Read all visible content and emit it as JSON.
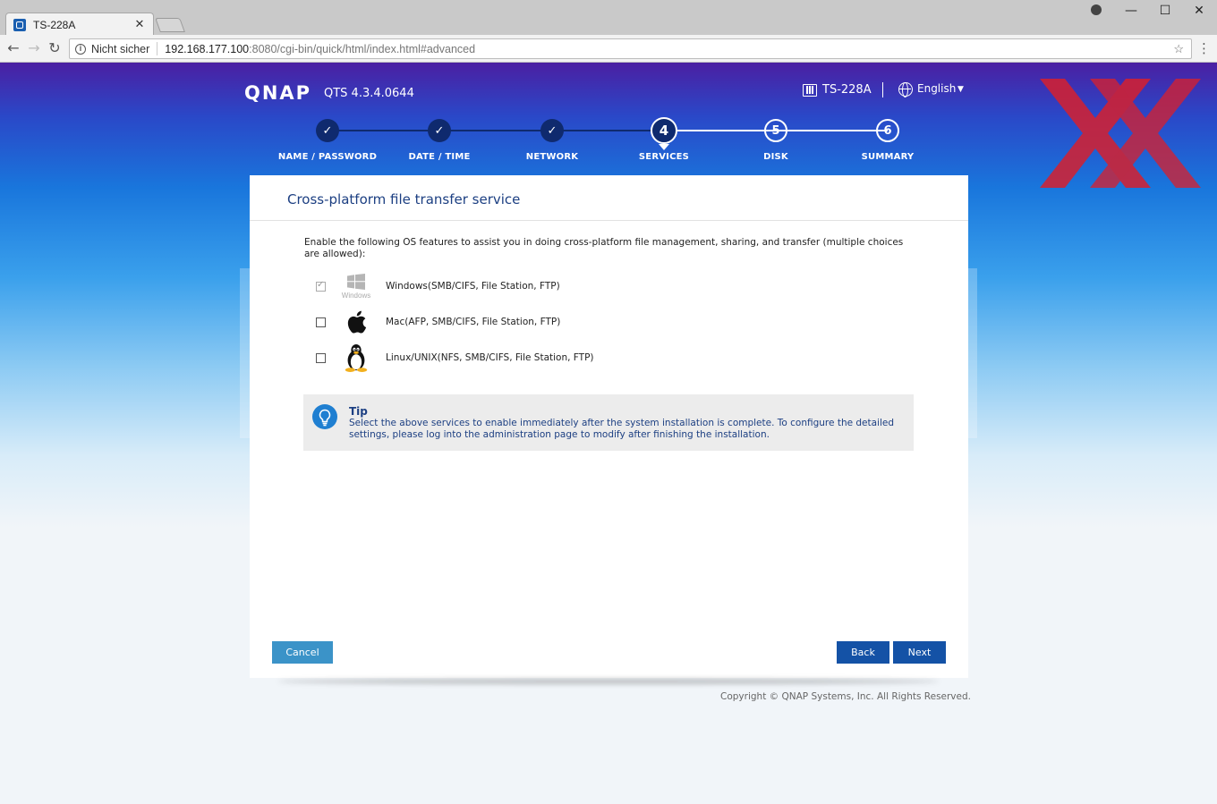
{
  "browser": {
    "tab_title": "TS-228A",
    "tab_close": "✕",
    "security_label": "Nicht sicher",
    "url_host": "192.168.177.100",
    "url_path": ":8080/cgi-bin/quick/html/index.html#advanced",
    "window_minimize": "—",
    "window_maximize": "☐",
    "window_close": "✕"
  },
  "header": {
    "logo": "QNAP",
    "version": "QTS 4.3.4.0644",
    "device_name": "TS-228A",
    "language": "English"
  },
  "steps": [
    {
      "number": "✓",
      "label": "NAME / PASSWORD",
      "state": "done"
    },
    {
      "number": "✓",
      "label": "DATE / TIME",
      "state": "done"
    },
    {
      "number": "✓",
      "label": "NETWORK",
      "state": "done"
    },
    {
      "number": "4",
      "label": "SERVICES",
      "state": "active"
    },
    {
      "number": "5",
      "label": "DISK",
      "state": "future"
    },
    {
      "number": "6",
      "label": "SUMMARY",
      "state": "future"
    }
  ],
  "card": {
    "title": "Cross-platform file transfer service",
    "intro": "Enable the following OS features to assist you in doing cross-platform file management, sharing, and transfer (multiple choices are allowed):",
    "options": [
      {
        "label": "Windows(SMB/CIFS, File Station, FTP)",
        "icon": "windows-icon",
        "icon_caption": "Windows",
        "checked": true,
        "disabled": true
      },
      {
        "label": "Mac(AFP, SMB/CIFS, File Station, FTP)",
        "icon": "apple-icon",
        "checked": false,
        "disabled": false
      },
      {
        "label": "Linux/UNIX(NFS, SMB/CIFS, File Station, FTP)",
        "icon": "tux-icon",
        "checked": false,
        "disabled": false
      }
    ],
    "tip": {
      "title": "Tip",
      "text": "Select the above services to enable immediately after the system installation is complete. To configure the detailed settings, please log into the administration page to modify after finishing the installation."
    },
    "buttons": {
      "cancel": "Cancel",
      "back": "Back",
      "next": "Next"
    }
  },
  "footer": {
    "copyright": "Copyright © QNAP Systems, Inc. All Rights Reserved."
  },
  "colors": {
    "brand_dark": "#0f2a6e",
    "title_blue": "#1c3f82",
    "button_blue": "#1452a6",
    "cancel_blue": "#3b93c8",
    "watermark_red": "#d6202f"
  }
}
